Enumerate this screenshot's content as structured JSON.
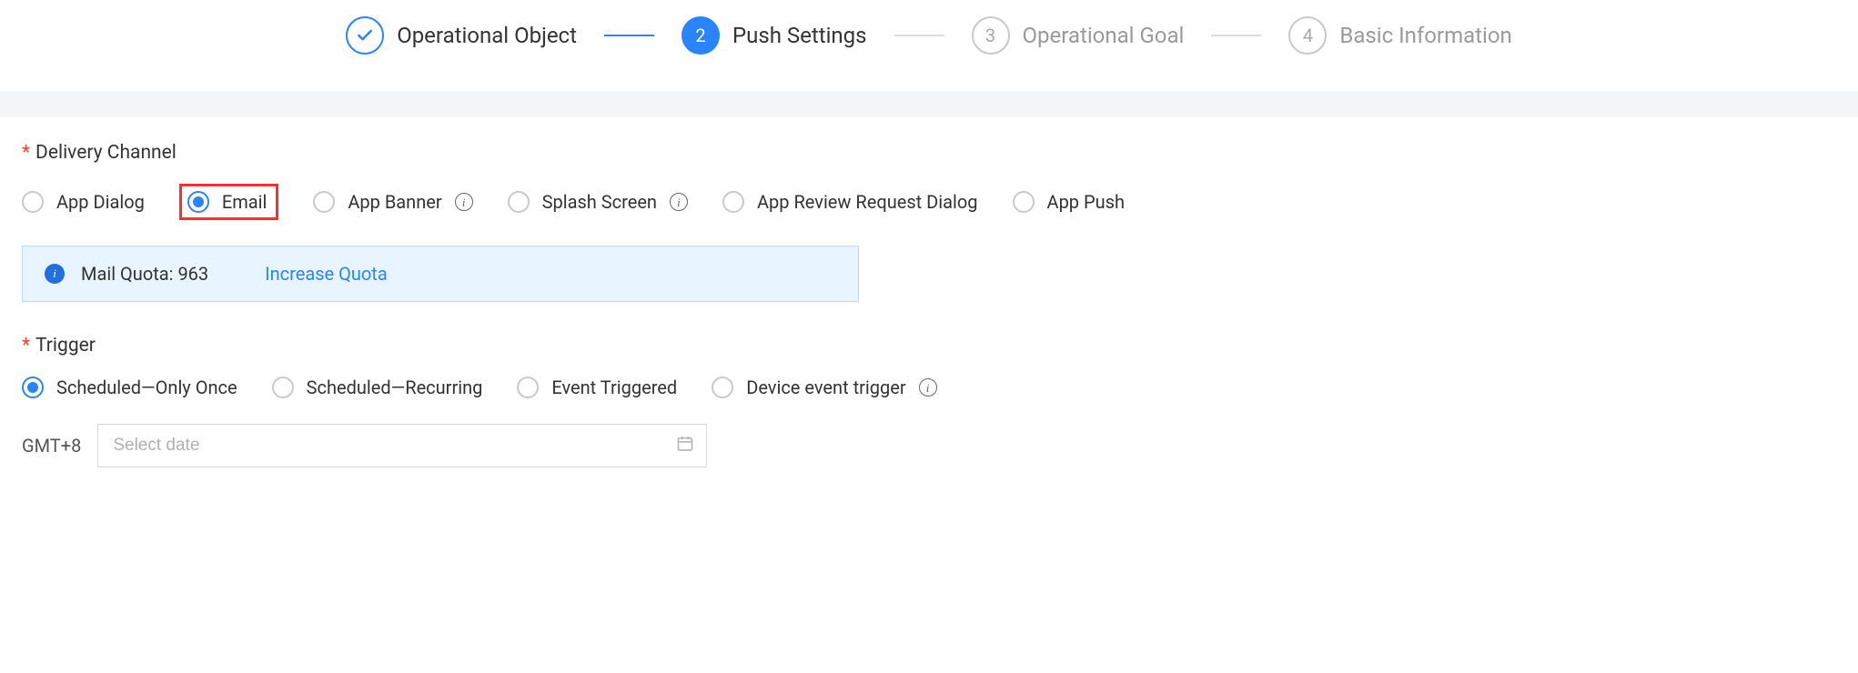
{
  "stepper": {
    "steps": [
      {
        "label": "Operational Object",
        "status": "completed"
      },
      {
        "num": "2",
        "label": "Push Settings",
        "status": "active"
      },
      {
        "num": "3",
        "label": "Operational Goal",
        "status": "pending"
      },
      {
        "num": "4",
        "label": "Basic Information",
        "status": "pending"
      }
    ]
  },
  "delivery_channel": {
    "label": "Delivery Channel",
    "options": {
      "app_dialog": "App Dialog",
      "email": "Email",
      "app_banner": "App Banner",
      "splash_screen": "Splash Screen",
      "app_review": "App Review Request Dialog",
      "app_push": "App Push"
    },
    "selected": "email"
  },
  "quota_alert": {
    "text": "Mail Quota: 963",
    "link": "Increase Quota"
  },
  "trigger": {
    "label": "Trigger",
    "options": {
      "scheduled_once": "Scheduled—Only Once",
      "scheduled_recurring": "Scheduled—Recurring",
      "event_triggered": "Event Triggered",
      "device_event_trigger": "Device event trigger"
    },
    "selected": "scheduled_once"
  },
  "date": {
    "timezone": "GMT+8",
    "placeholder": "Select date",
    "value": ""
  }
}
